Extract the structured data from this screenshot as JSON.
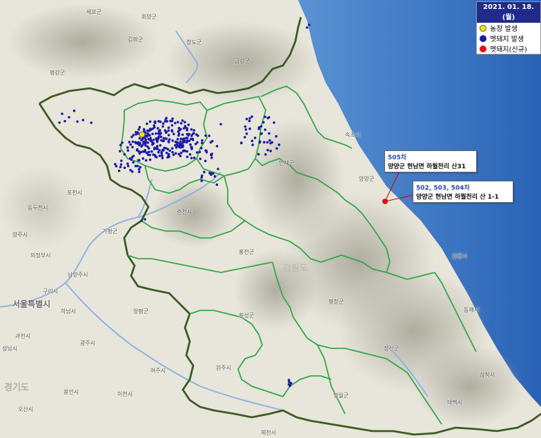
{
  "legend": {
    "date": "2021. 01. 18. (월)",
    "items": [
      {
        "label": "농장 발생",
        "color": "#f2e500",
        "border": "#555555"
      },
      {
        "label": "멧돼지 발생",
        "color": "#1a1aa6",
        "border": "#1a1aa6"
      },
      {
        "label": "멧돼지(신규)",
        "color": "#e8101a",
        "border": "#e8101a"
      }
    ]
  },
  "callouts": [
    {
      "order": "505차",
      "location": "양양군 현남면 하월천리 산31"
    },
    {
      "order": "502, 503, 504차",
      "location": "양양군 현남면 하월천리 산 1-1"
    }
  ],
  "place_labels": [
    "세포군",
    "회양군",
    "평강군",
    "김화군",
    "창도군",
    "금강군",
    "속초시",
    "양양군",
    "인제군",
    "포천시",
    "동두천시",
    "가평군",
    "춘천시",
    "양주시",
    "의정부시",
    "남양주시",
    "구리시",
    "서울특별시",
    "하남시",
    "홍천군",
    "강릉시",
    "평창군",
    "횡성군",
    "양평군",
    "원주시",
    "정선군",
    "동해시",
    "삼척시",
    "광주시",
    "여주시",
    "용인시",
    "이천시",
    "영월군",
    "태백시",
    "제천시",
    "경기도",
    "오산시",
    "과천시",
    "성남시",
    "강원도"
  ],
  "colors": {
    "sea": "#2f72c4",
    "land": "#e6e3d8",
    "boundary_outer": "#3a5a22",
    "boundary_inner": "#2fa84a",
    "river": "#8fb3e0",
    "case_dot": "#1a1aa6",
    "farm_dot": "#f2e500",
    "new_dot": "#e8101a"
  }
}
